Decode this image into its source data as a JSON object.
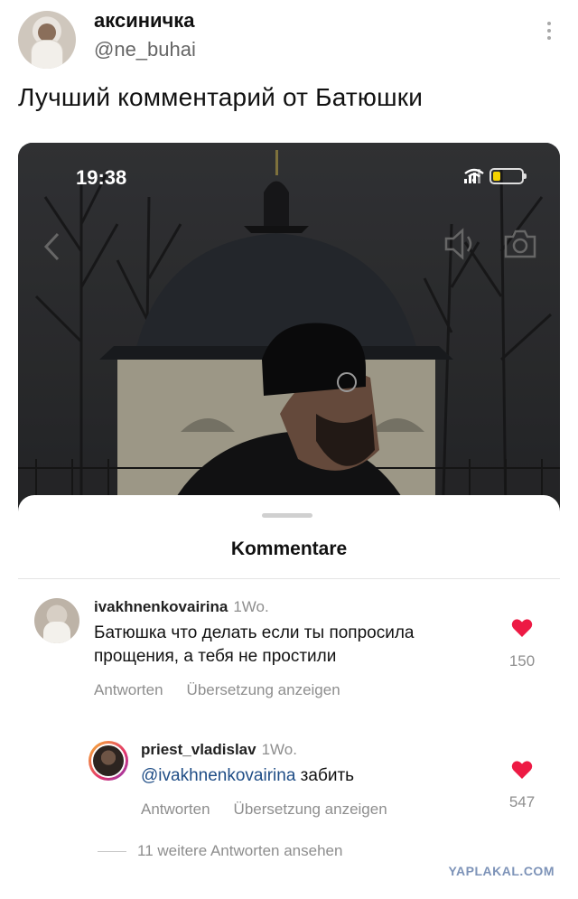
{
  "tweet": {
    "name": "аксиничка",
    "handle": "@ne_buhai",
    "text": "Лучший комментарий от Батюшки"
  },
  "screenshot": {
    "status_bar": {
      "time": "19:38",
      "battery_color": "#f5d300"
    },
    "icons": [
      "back-icon",
      "speaker-icon",
      "camera-icon"
    ],
    "sheet": {
      "title": "Kommentare",
      "comments": [
        {
          "user": "ivakhnenkovairina",
          "time": "1Wo.",
          "text_line1": "Батюшка  что делать  если ты попросила",
          "text_line2": "прощения,  а тебя  не простили",
          "likes": "150",
          "reply": "Antworten",
          "translate": "Übersetzung anzeigen"
        },
        {
          "user": "priest_vladislav",
          "time": "1Wo.",
          "mention": "@ivakhnenkovairina",
          "text": " забить",
          "likes": "547",
          "reply": "Antworten",
          "translate": "Übersetzung anzeigen"
        }
      ],
      "more_replies": "11 weitere Antworten ansehen"
    }
  },
  "watermark": "YAPLAKAL.COM",
  "colors": {
    "heart": "#ed1a44",
    "mention": "#1f4d86",
    "muted": "#8e8e8e"
  }
}
